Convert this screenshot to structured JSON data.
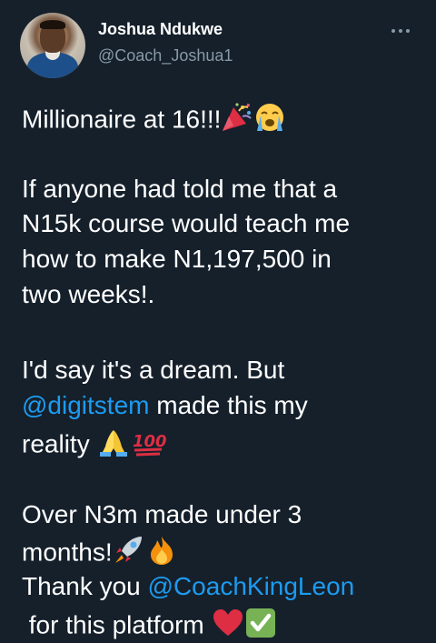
{
  "author": {
    "name": "Joshua Ndukwe",
    "handle": "@Coach_Joshua1"
  },
  "tweet": {
    "line1": "Millionaire at 16!!!",
    "line2": "If anyone had told me that a",
    "line3": "N15k course would teach me",
    "line4": "how to make N1,197,500 in",
    "line5": "two weeks!.",
    "line6": "I'd say it's a dream. But",
    "mention1": "@digitstem",
    "line7_rest": " made this my",
    "line8": "reality ",
    "line9": "Over N3m made under 3",
    "line10": "months!",
    "line11_start": "Thank you ",
    "mention2": "@CoachKingLeon",
    "line12": " for this platform "
  },
  "icons": {
    "more": "more-dots-icon",
    "party": "party-popper-emoji",
    "crying": "loudly-crying-emoji",
    "pray": "folded-hands-emoji",
    "hundred": "hundred-points-emoji",
    "rocket": "rocket-emoji",
    "fire": "fire-emoji",
    "heart": "red-heart-emoji",
    "check": "check-mark-button-emoji"
  },
  "colors": {
    "background": "#15202b",
    "text": "#ffffff",
    "secondary": "#8899a6",
    "link": "#1d9bf0"
  }
}
